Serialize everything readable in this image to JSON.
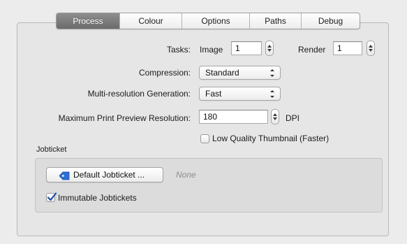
{
  "tabs": [
    {
      "label": "Process",
      "active": true
    },
    {
      "label": "Colour",
      "active": false
    },
    {
      "label": "Options",
      "active": false
    },
    {
      "label": "Paths",
      "active": false
    },
    {
      "label": "Debug",
      "active": false
    }
  ],
  "tasks": {
    "label": "Tasks:",
    "image_label": "Image",
    "image_value": "1",
    "render_label": "Render",
    "render_value": "1"
  },
  "compression": {
    "label": "Compression:",
    "selected": "Standard"
  },
  "multires": {
    "label": "Multi-resolution Generation:",
    "selected": "Fast"
  },
  "max_preview": {
    "label": "Maximum Print Preview Resolution:",
    "value": "180",
    "unit": "DPI"
  },
  "low_quality_thumbnail": {
    "label": "Low Quality Thumbnail (Faster)",
    "checked": false
  },
  "jobticket": {
    "section_label": "Jobticket",
    "default_button_label": "Default Jobticket ...",
    "default_value": "None",
    "immutable_label": "Immutable Jobtickets",
    "immutable_checked": true
  },
  "colors": {
    "active_tab": "#7a7a7a",
    "tag_icon": "#2a6fd8",
    "checkbox_mark": "#1f4fa8"
  }
}
